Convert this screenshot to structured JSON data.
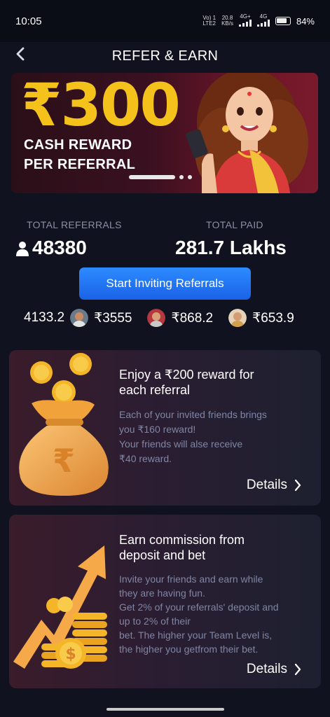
{
  "status_bar": {
    "time": "10:05",
    "network_line1": "Vo) 1",
    "network_line2": "LTE2",
    "speed_line1": "20.8",
    "speed_line2": "KB/s",
    "net_type1": "4G+",
    "net_type2": "4G",
    "battery": "84%"
  },
  "header": {
    "title": "REFER & EARN",
    "back_icon": "chevron-left-icon"
  },
  "banner": {
    "amount": "₹300",
    "line1": "CASH REWARD",
    "line2": "PER REFERRAL",
    "slide_index": 1,
    "slide_count": 3,
    "accent": "#f5c21b"
  },
  "stats": {
    "referrals_label": "TOTAL REFERRALS",
    "referrals_value": "48380",
    "paid_label": "TOTAL PAID",
    "paid_value": "281.7 Lakhs"
  },
  "invite_button": {
    "label": "Start Inviting Referrals",
    "color": "#1f6ff0"
  },
  "ticker": [
    {
      "amount": "4133.2"
    },
    {
      "amount": "₹3555"
    },
    {
      "amount": "₹868.2"
    },
    {
      "amount": "₹653.9"
    }
  ],
  "card1": {
    "title_line1": "Enjoy a ₹200 reward for",
    "title_line2": "each referral",
    "desc_lines": [
      "Each of your invited friends brings",
      "you ₹160 reward!",
      "Your friends will alse receive",
      "₹40 reward."
    ],
    "details": "Details"
  },
  "card2": {
    "title_line1": "Earn commission from",
    "title_line2": "deposit and bet",
    "desc_lines": [
      "Invite your friends and earn while",
      "they are having fun.",
      "Get 2% of your referrals' deposit and",
      "up to 2% of their",
      "bet. The higher your Team Level is,",
      "the higher you getfrom their bet."
    ],
    "details": "Details"
  }
}
